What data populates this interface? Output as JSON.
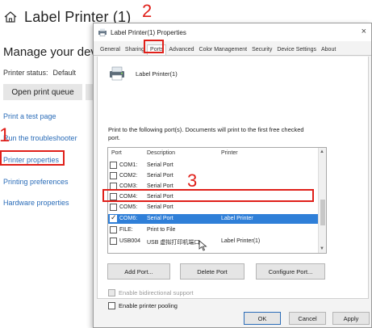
{
  "background": {
    "title": "Label Printer (1)",
    "subtitle": "Manage your devi",
    "status_label": "Printer status:",
    "status_value": "Default",
    "open_queue_label": "Open print queue",
    "links": [
      "Print a test page",
      "Run the troubleshooter",
      "Printer properties",
      "Printing preferences",
      "Hardware properties"
    ]
  },
  "annotations": {
    "step1": "1",
    "step2": "2",
    "step3": "3",
    "color": "#e0201a"
  },
  "dialog": {
    "title": "Label Printer(1) Properties",
    "close_glyph": "×",
    "tabs": [
      "General",
      "Sharing",
      "Ports",
      "Advanced",
      "Color Management",
      "Security",
      "Device Settings",
      "About"
    ],
    "active_tab": "Ports",
    "printer_name": "Label Printer(1)",
    "instructions": "Print to the following port(s). Documents will print to the first free checked port.",
    "columns": {
      "port": "Port",
      "description": "Description",
      "printer": "Printer"
    },
    "ports": [
      {
        "port": "COM1:",
        "description": "Serial Port",
        "printer": "",
        "checked": false
      },
      {
        "port": "COM2:",
        "description": "Serial Port",
        "printer": "",
        "checked": false
      },
      {
        "port": "COM3:",
        "description": "Serial Port",
        "printer": "",
        "checked": false
      },
      {
        "port": "COM4:",
        "description": "Serial Port",
        "printer": "",
        "checked": false
      },
      {
        "port": "COM5:",
        "description": "Serial Port",
        "printer": "",
        "checked": false
      },
      {
        "port": "COM6:",
        "description": "Serial Port",
        "printer": "Label Printer",
        "checked": true,
        "selected": true
      },
      {
        "port": "FILE:",
        "description": "Print to File",
        "printer": "",
        "checked": false
      },
      {
        "port": "USB004",
        "description": "USB 虚拟打印机端口",
        "printer": "Label Printer(1)",
        "checked": false
      }
    ],
    "add_port_label": "Add Port...",
    "delete_port_label": "Delete Port",
    "configure_port_label": "Configure Port...",
    "bidirectional_label": "Enable bidirectional support",
    "pooling_label": "Enable printer pooling",
    "ok_label": "OK",
    "cancel_label": "Cancel",
    "apply_label": "Apply",
    "accent": "#2f7fd8"
  }
}
